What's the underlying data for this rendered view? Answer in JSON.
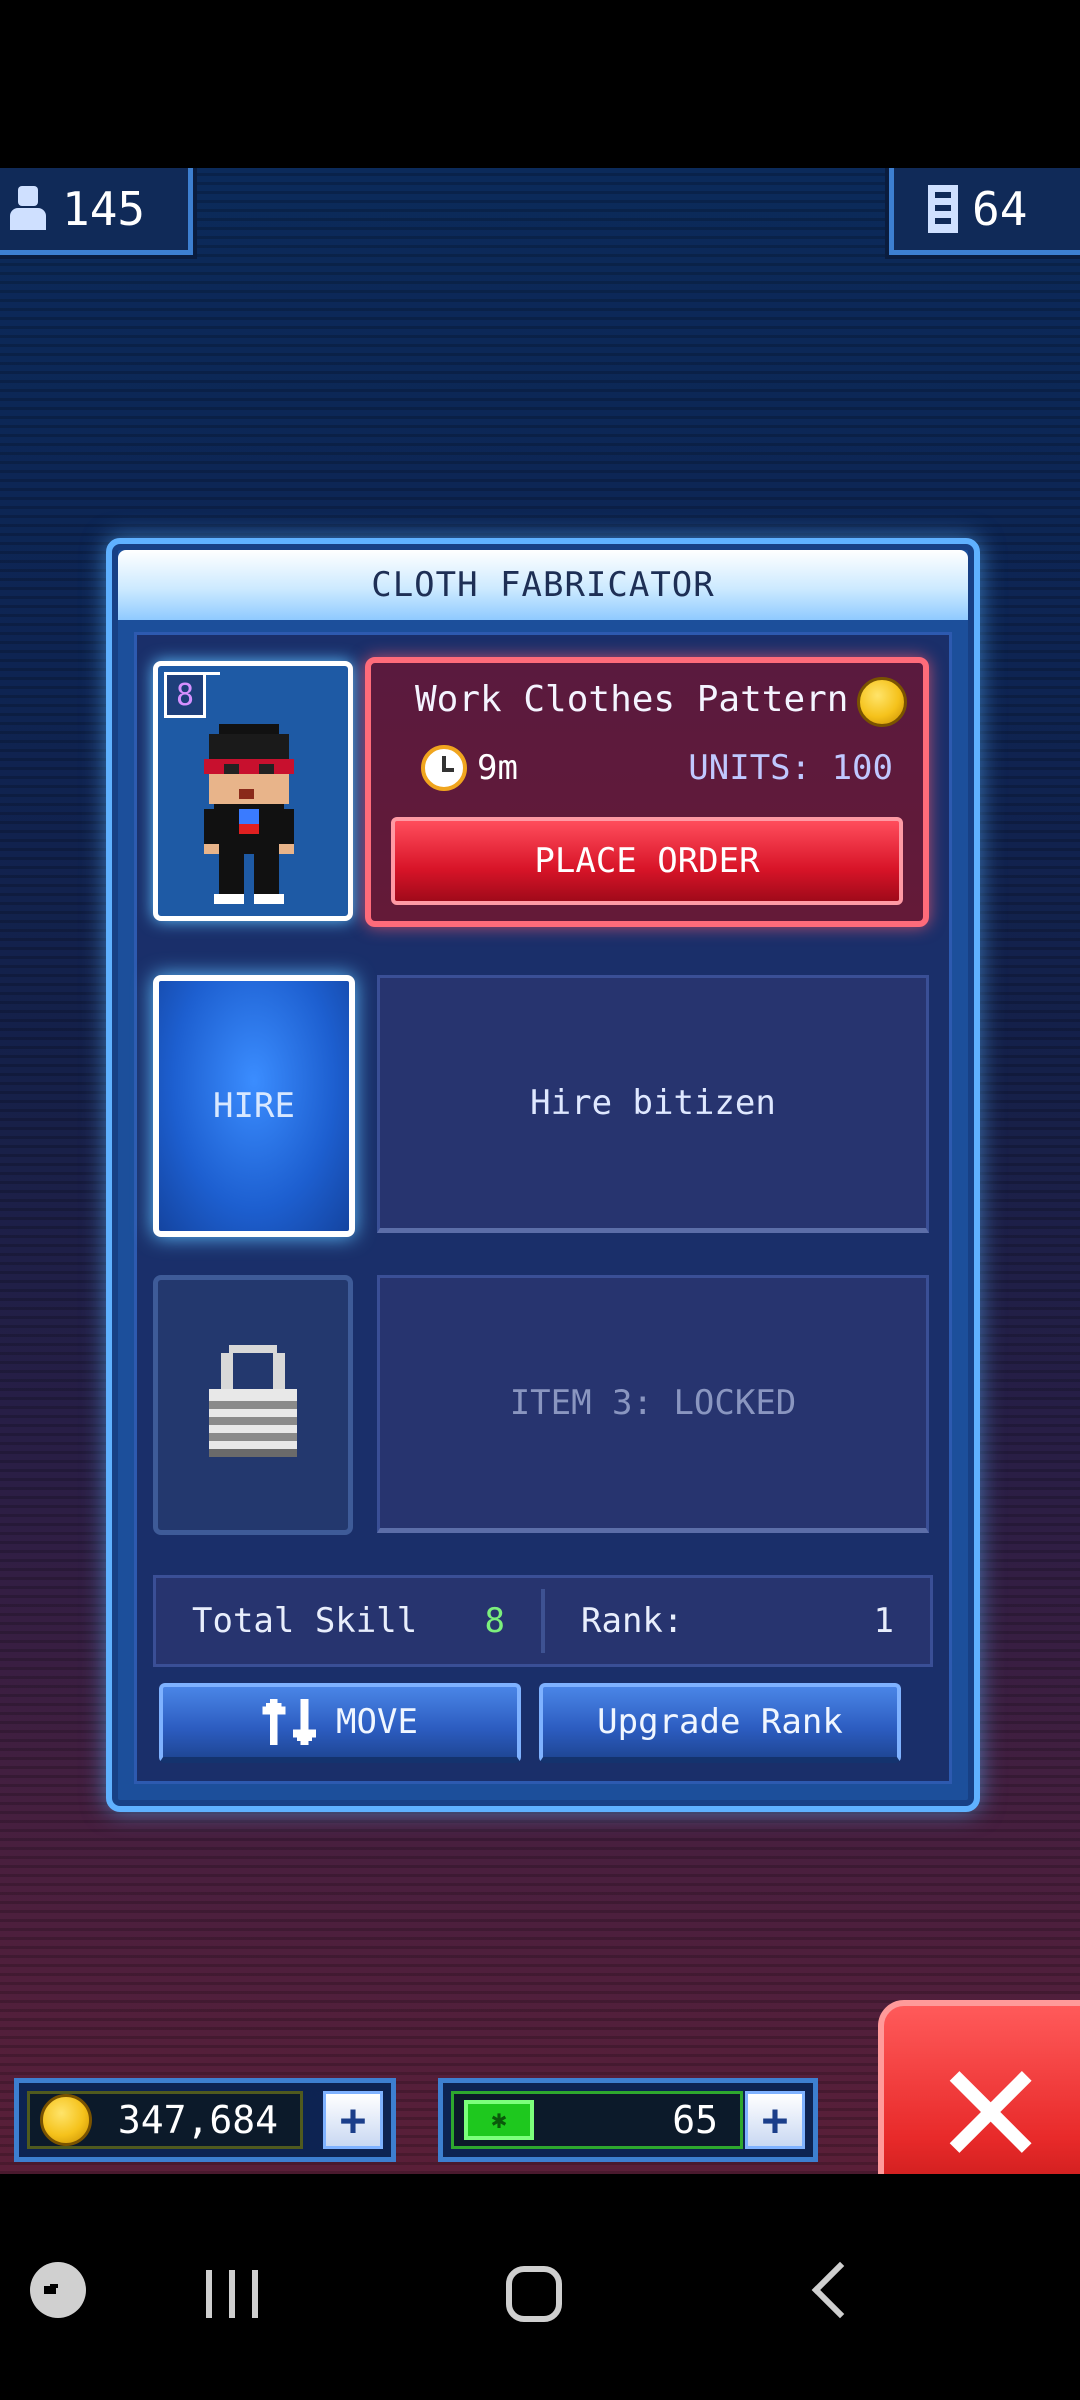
{
  "hud": {
    "population": "145",
    "floors": "64",
    "population_icon": "person-icon",
    "floors_icon": "building-icon"
  },
  "panel": {
    "title": "CLOTH FABRICATOR",
    "worker": {
      "level": "8"
    },
    "order": {
      "item_name": "Work Clothes Pattern",
      "time": "9m",
      "units": "UNITS: 100",
      "button": "PLACE ORDER"
    },
    "hire_slot": {
      "button": "HIRE",
      "text": "Hire bitizen"
    },
    "locked_slot": {
      "text": "ITEM 3: LOCKED"
    },
    "stats": {
      "skill_label": "Total Skill",
      "skill_value": "8",
      "rank_label": "Rank:",
      "rank_value": "1"
    },
    "buttons": {
      "move": "MOVE",
      "upgrade": "Upgrade Rank"
    }
  },
  "currency": {
    "coins": "347,684",
    "bux": "65"
  },
  "colors": {
    "accent_blue": "#5fb1ff",
    "order_red": "#d81428",
    "skill_green": "#7cf07c",
    "coin_gold": "#f5c21b"
  }
}
